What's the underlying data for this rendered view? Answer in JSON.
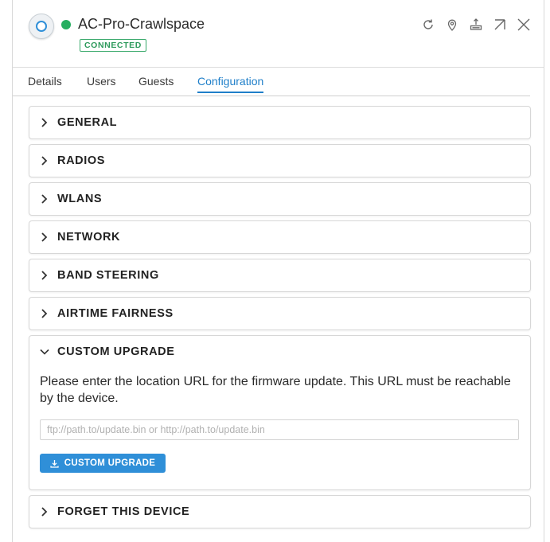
{
  "device": {
    "name": "AC-Pro-Crawlspace",
    "status": "CONNECTED",
    "status_color": "#27ae60"
  },
  "header_icons": [
    "refresh-icon",
    "locate-icon",
    "upload-icon",
    "popout-icon",
    "close-icon"
  ],
  "tabs": [
    {
      "label": "Details"
    },
    {
      "label": "Users"
    },
    {
      "label": "Guests"
    },
    {
      "label": "Configuration",
      "active": true
    }
  ],
  "sections": {
    "general": "GENERAL",
    "radios": "RADIOS",
    "wlans": "WLANS",
    "network": "NETWORK",
    "band_steering": "BAND STEERING",
    "airtime_fairness": "AIRTIME FAIRNESS",
    "forget_device": "FORGET THIS DEVICE"
  },
  "custom_upgrade": {
    "title": "CUSTOM UPGRADE",
    "expanded": true,
    "description": "Please enter the location URL for the firmware update. This URL must be reachable by the device.",
    "url_value": "",
    "url_placeholder": "ftp://path.to/update.bin or http://path.to/update.bin",
    "button_label": "CUSTOM UPGRADE"
  },
  "colors": {
    "accent": "#2f8fd8",
    "connected": "#27ae60"
  }
}
